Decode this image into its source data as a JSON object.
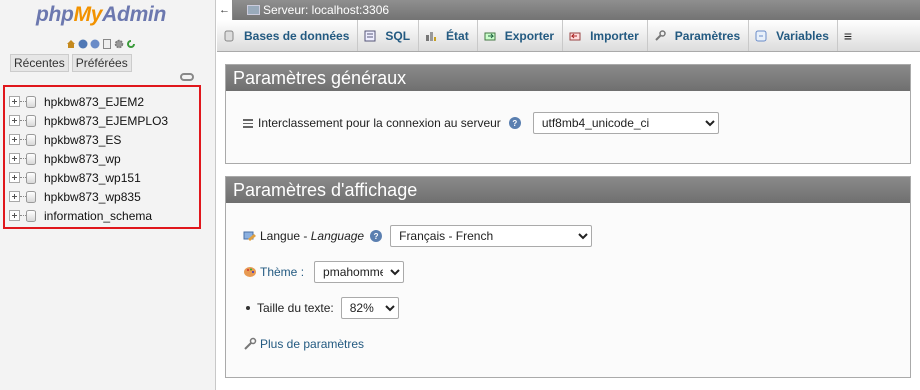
{
  "logo": {
    "php": "php",
    "my": "My",
    "admin": "Admin"
  },
  "nav": {
    "tabs": [
      "Récentes",
      "Préférées"
    ],
    "databases": [
      "hpkbw873_EJEM2",
      "hpkbw873_EJEMPLO3",
      "hpkbw873_ES",
      "hpkbw873_wp",
      "hpkbw873_wp151",
      "hpkbw873_wp835",
      "information_schema"
    ]
  },
  "server_bar": {
    "label": "Serveur: localhost:3306"
  },
  "menu": {
    "tabs": [
      {
        "label": "Bases de données",
        "icon": "database-icon"
      },
      {
        "label": "SQL",
        "icon": "sql-icon"
      },
      {
        "label": "État",
        "icon": "status-icon"
      },
      {
        "label": "Exporter",
        "icon": "export-icon"
      },
      {
        "label": "Importer",
        "icon": "import-icon"
      },
      {
        "label": "Paramètres",
        "icon": "wrench-icon"
      },
      {
        "label": "Variables",
        "icon": "variables-icon"
      }
    ]
  },
  "general": {
    "title": "Paramètres généraux",
    "collation_label": "Interclassement pour la connexion au serveur",
    "collation_value": "utf8mb4_unicode_ci"
  },
  "display": {
    "title": "Paramètres d'affichage",
    "language_label": "Langue - ",
    "language_label_italic": "Language",
    "language_value": "Français - French",
    "theme_label": "Thème",
    "theme_colon": " :",
    "theme_value": "pmahomme",
    "fontsize_label": "Taille du texte:",
    "fontsize_value": "82%",
    "more_settings": "Plus de paramètres"
  }
}
